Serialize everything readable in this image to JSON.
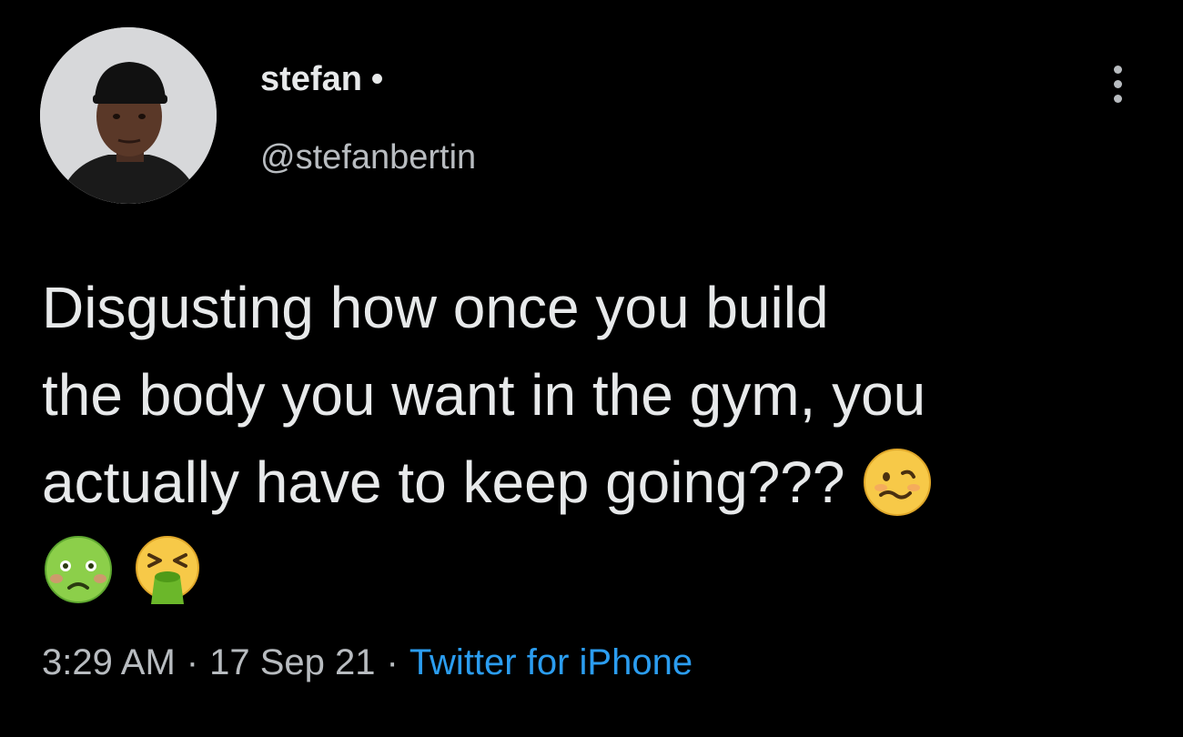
{
  "author": {
    "display_name": "stefan",
    "name_separator": "•",
    "handle": "@stefanbertin"
  },
  "tweet": {
    "line1": "Disgusting how once you build",
    "line2": "the body you want in the gym, you",
    "line3": "actually have to keep going???",
    "emojis": [
      "woozy-face",
      "nauseated-face",
      "vomiting-face"
    ]
  },
  "meta": {
    "time": "3:29 AM",
    "separator": "·",
    "date": "17 Sep 21",
    "source": "Twitter for iPhone"
  },
  "colors": {
    "background": "#000000",
    "text": "#e7e9ea",
    "secondary_text": "#b8bcc0",
    "link": "#2b9df0"
  }
}
